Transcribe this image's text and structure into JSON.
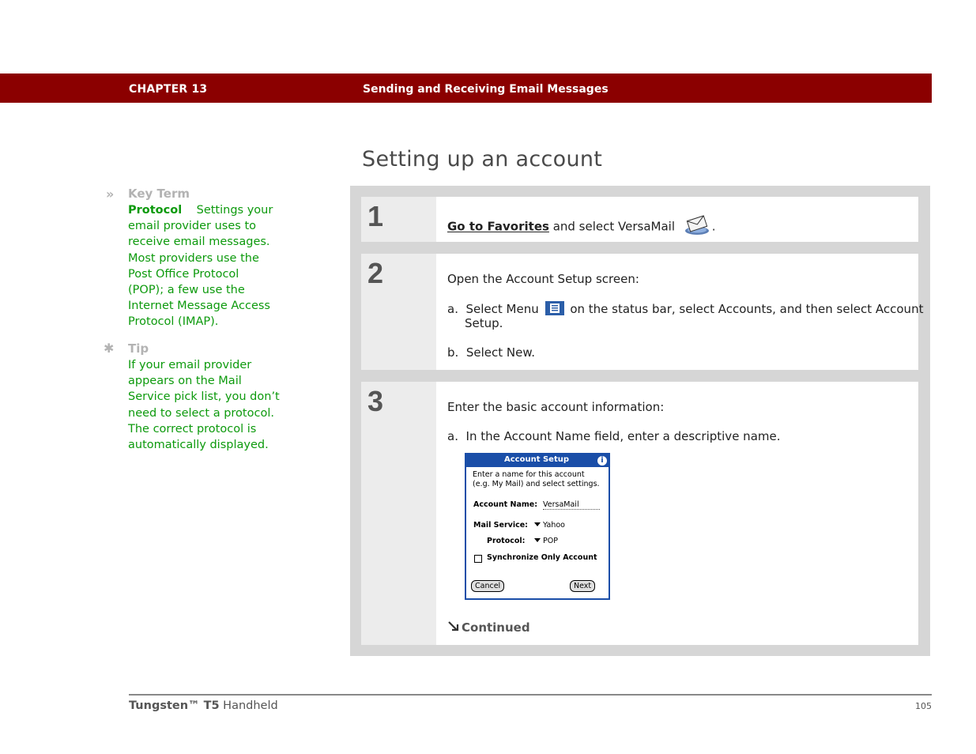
{
  "header": {
    "chapter": "CHAPTER 13",
    "title": "Sending and Receiving Email Messages",
    "color": "#8b0000"
  },
  "page_title": "Setting up an account",
  "sidebar": {
    "key_term": {
      "marker": "»",
      "heading": "Key Term",
      "term": "Protocol",
      "lines": [
        "Settings your",
        "email provider uses to",
        "receive email messages.",
        "Most providers use the",
        "Post Office Protocol",
        "(POP); a few use the",
        "Internet Message Access",
        "Protocol (IMAP)."
      ]
    },
    "tip": {
      "marker": "✱",
      "heading": "Tip",
      "lines": [
        "If your email provider",
        "appears on the Mail",
        "Service pick list, you don’t",
        "need to select a protocol.",
        "The correct protocol is",
        "automatically displayed."
      ]
    },
    "text_color": "#0d9a0d"
  },
  "steps": [
    {
      "number": "1",
      "link": "Go to Favorites",
      "text": " and select VersaMail",
      "suffix": ".",
      "icon": "versamail-envelope-icon"
    },
    {
      "number": "2",
      "intro": "Open the Account Setup screen:",
      "a_label": "a.",
      "a_text_1": "Select Menu",
      "a_text_2": "on the status bar, select Accounts, and then select Account",
      "a_text_3": "Setup.",
      "b_label": "b.",
      "b_text": "Select New.",
      "icon": "menu-icon"
    },
    {
      "number": "3",
      "intro": "Enter the basic account information:",
      "a_label": "a.",
      "a_text": "In the Account Name field, enter a descriptive name.",
      "continued": "Continued"
    }
  ],
  "palm_screen": {
    "title": "Account Setup",
    "info": "i",
    "line1": "Enter a name for this account",
    "line2": "(e.g. My Mail) and select settings.",
    "account_name_label": "Account Name:",
    "account_name_value": "VersaMail",
    "mail_service_label": "Mail Service:",
    "mail_service_value": "Yahoo",
    "protocol_label": "Protocol:",
    "protocol_value": "POP",
    "sync_label": "Synchronize Only Account",
    "cancel": "Cancel",
    "next": "Next"
  },
  "footer": {
    "product_bold": "Tungsten™ T5",
    "product_rest": " Handheld",
    "page_number": "105"
  }
}
